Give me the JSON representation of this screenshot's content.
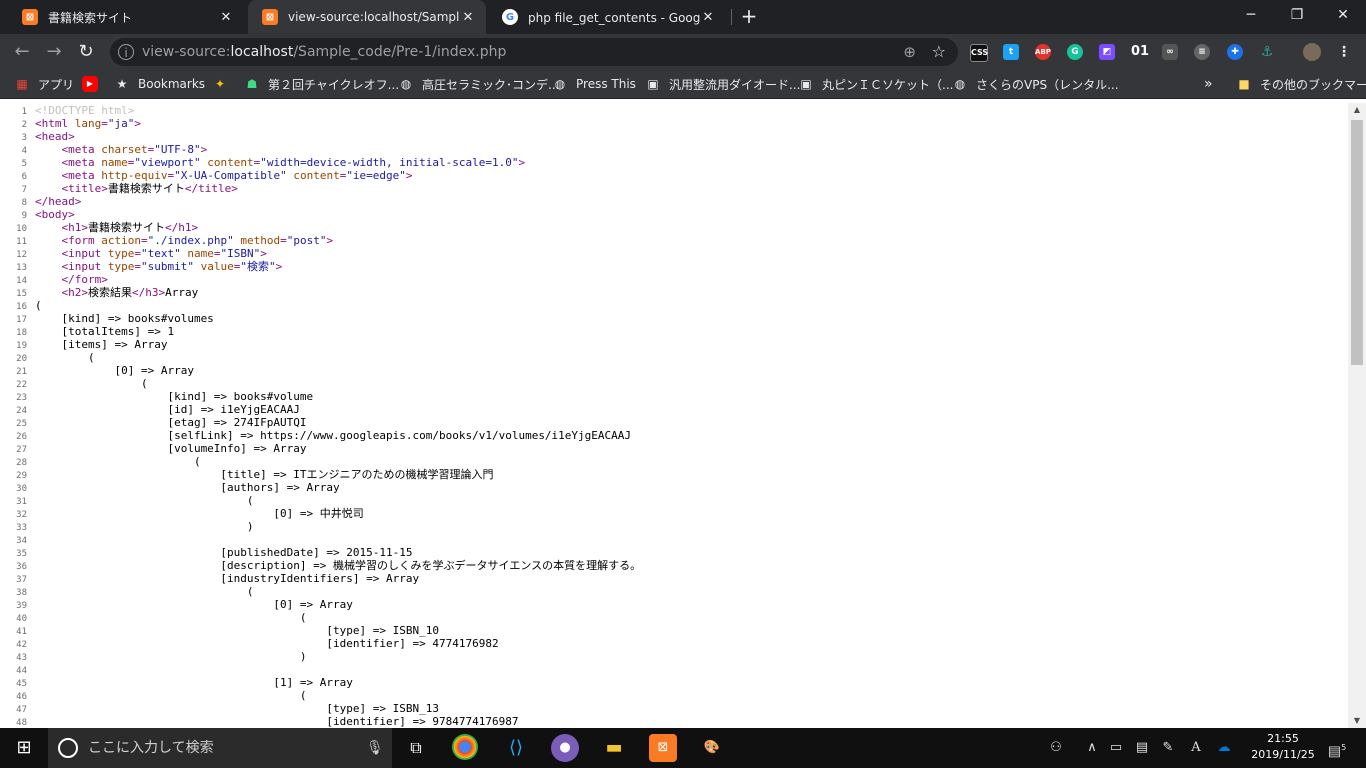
{
  "tabs": [
    {
      "title": "書籍検索サイト",
      "favicon": "xampp-icon",
      "active": false
    },
    {
      "title": "view-source:localhost/Sample_co",
      "favicon": "xampp-icon",
      "active": true
    },
    {
      "title": "php file_get_contents - Google 検",
      "favicon": "google-icon",
      "active": false
    }
  ],
  "window_controls": {
    "minimize": "─",
    "maximize": "❐",
    "close": "✕"
  },
  "toolbar": {
    "url_prefix": "view-source:",
    "url_host": "localhost",
    "url_path": "/Sample_code/Pre-1/index.php",
    "extensions": [
      "CSS",
      "twitter",
      "ABP",
      "grammarly",
      "color",
      "01",
      "cam",
      "chat",
      "plug",
      "tree",
      "avatar"
    ]
  },
  "bookmarks": [
    {
      "label": "アプリ",
      "icon": "apps-grid-icon"
    },
    {
      "label": "",
      "icon": "youtube-icon"
    },
    {
      "label": "Bookmarks",
      "icon": "star-icon"
    },
    {
      "label": "",
      "icon": "colorful-icon"
    },
    {
      "label": "第２回チャイクレオフ...",
      "icon": "android-icon"
    },
    {
      "label": "高圧セラミック･コンデ...",
      "icon": "globe-icon"
    },
    {
      "label": "Press This",
      "icon": "globe-icon"
    },
    {
      "label": "汎用整流用ダイオード...",
      "icon": "chip-icon"
    },
    {
      "label": "丸ピンＩＣソケット（...",
      "icon": "chip-icon"
    },
    {
      "label": "さくらのVPS（レンタル...",
      "icon": "globe-icon"
    },
    {
      "label": "»",
      "icon": ""
    },
    {
      "label": "その他のブックマーク",
      "icon": "folder-icon"
    }
  ],
  "source_lines": [
    [
      [
        "cmt",
        "<!DOCTYPE html>"
      ]
    ],
    [
      [
        "tag",
        "<html "
      ],
      [
        "attr",
        "lang"
      ],
      [
        "tag",
        "="
      ],
      [
        "val",
        "\"ja\""
      ],
      [
        "tag",
        ">"
      ]
    ],
    [
      [
        "tag",
        "<head>"
      ]
    ],
    [
      [
        "txt",
        "    "
      ],
      [
        "tag",
        "<meta "
      ],
      [
        "attr",
        "charset"
      ],
      [
        "tag",
        "="
      ],
      [
        "val",
        "\"UTF-8\""
      ],
      [
        "tag",
        ">"
      ]
    ],
    [
      [
        "txt",
        "    "
      ],
      [
        "tag",
        "<meta "
      ],
      [
        "attr",
        "name"
      ],
      [
        "tag",
        "="
      ],
      [
        "val",
        "\"viewport\""
      ],
      [
        "txt",
        " "
      ],
      [
        "attr",
        "content"
      ],
      [
        "tag",
        "="
      ],
      [
        "val",
        "\"width=device-width, initial-scale=1.0\""
      ],
      [
        "tag",
        ">"
      ]
    ],
    [
      [
        "txt",
        "    "
      ],
      [
        "tag",
        "<meta "
      ],
      [
        "attr",
        "http-equiv"
      ],
      [
        "tag",
        "="
      ],
      [
        "val",
        "\"X-UA-Compatible\""
      ],
      [
        "txt",
        " "
      ],
      [
        "attr",
        "content"
      ],
      [
        "tag",
        "="
      ],
      [
        "val",
        "\"ie=edge\""
      ],
      [
        "tag",
        ">"
      ]
    ],
    [
      [
        "txt",
        "    "
      ],
      [
        "tag",
        "<title>"
      ],
      [
        "txt",
        "書籍検索サイト"
      ],
      [
        "tag",
        "</title>"
      ]
    ],
    [
      [
        "tag",
        "</head>"
      ]
    ],
    [
      [
        "tag",
        "<body>"
      ]
    ],
    [
      [
        "txt",
        "    "
      ],
      [
        "tag",
        "<h1>"
      ],
      [
        "txt",
        "書籍検索サイト"
      ],
      [
        "tag",
        "</h1>"
      ]
    ],
    [
      [
        "txt",
        "    "
      ],
      [
        "tag",
        "<form "
      ],
      [
        "attr",
        "action"
      ],
      [
        "tag",
        "="
      ],
      [
        "val",
        "\"./index.php\""
      ],
      [
        "txt",
        " "
      ],
      [
        "attr",
        "method"
      ],
      [
        "tag",
        "="
      ],
      [
        "val",
        "\"post\""
      ],
      [
        "tag",
        ">"
      ]
    ],
    [
      [
        "txt",
        "    "
      ],
      [
        "tag",
        "<input "
      ],
      [
        "attr",
        "type"
      ],
      [
        "tag",
        "="
      ],
      [
        "val",
        "\"text\""
      ],
      [
        "txt",
        " "
      ],
      [
        "attr",
        "name"
      ],
      [
        "tag",
        "="
      ],
      [
        "val",
        "\"ISBN\""
      ],
      [
        "tag",
        ">"
      ]
    ],
    [
      [
        "txt",
        "    "
      ],
      [
        "tag",
        "<input "
      ],
      [
        "attr",
        "type"
      ],
      [
        "tag",
        "="
      ],
      [
        "val",
        "\"submit\""
      ],
      [
        "txt",
        " "
      ],
      [
        "attr",
        "value"
      ],
      [
        "tag",
        "="
      ],
      [
        "val",
        "\"検索\""
      ],
      [
        "tag",
        ">"
      ]
    ],
    [
      [
        "txt",
        "    "
      ],
      [
        "tag",
        "</form>"
      ]
    ],
    [
      [
        "txt",
        "    "
      ],
      [
        "tag",
        "<h2>"
      ],
      [
        "txt",
        "検索結果"
      ],
      [
        "tag",
        "</h3>"
      ],
      [
        "txt",
        "Array"
      ]
    ],
    [
      [
        "txt",
        "("
      ]
    ],
    [
      [
        "txt",
        "    [kind] => books#volumes"
      ]
    ],
    [
      [
        "txt",
        "    [totalItems] => 1"
      ]
    ],
    [
      [
        "txt",
        "    [items] => Array"
      ]
    ],
    [
      [
        "txt",
        "        ("
      ]
    ],
    [
      [
        "txt",
        "            [0] => Array"
      ]
    ],
    [
      [
        "txt",
        "                ("
      ]
    ],
    [
      [
        "txt",
        "                    [kind] => books#volume"
      ]
    ],
    [
      [
        "txt",
        "                    [id] => i1eYjgEACAAJ"
      ]
    ],
    [
      [
        "txt",
        "                    [etag] => 274IFpAUTQI"
      ]
    ],
    [
      [
        "txt",
        "                    [selfLink] => https://www.googleapis.com/books/v1/volumes/i1eYjgEACAAJ"
      ]
    ],
    [
      [
        "txt",
        "                    [volumeInfo] => Array"
      ]
    ],
    [
      [
        "txt",
        "                        ("
      ]
    ],
    [
      [
        "txt",
        "                            [title] => ITエンジニアのための機械学習理論入門"
      ]
    ],
    [
      [
        "txt",
        "                            [authors] => Array"
      ]
    ],
    [
      [
        "txt",
        "                                ("
      ]
    ],
    [
      [
        "txt",
        "                                    [0] => 中井悦司"
      ]
    ],
    [
      [
        "txt",
        "                                )"
      ]
    ],
    [
      [
        "txt",
        ""
      ]
    ],
    [
      [
        "txt",
        "                            [publishedDate] => 2015-11-15"
      ]
    ],
    [
      [
        "txt",
        "                            [description] => 機械学習のしくみを学ぶデータサイエンスの本質を理解する。"
      ]
    ],
    [
      [
        "txt",
        "                            [industryIdentifiers] => Array"
      ]
    ],
    [
      [
        "txt",
        "                                ("
      ]
    ],
    [
      [
        "txt",
        "                                    [0] => Array"
      ]
    ],
    [
      [
        "txt",
        "                                        ("
      ]
    ],
    [
      [
        "txt",
        "                                            [type] => ISBN_10"
      ]
    ],
    [
      [
        "txt",
        "                                            [identifier] => 4774176982"
      ]
    ],
    [
      [
        "txt",
        "                                        )"
      ]
    ],
    [
      [
        "txt",
        ""
      ]
    ],
    [
      [
        "txt",
        "                                    [1] => Array"
      ]
    ],
    [
      [
        "txt",
        "                                        ("
      ]
    ],
    [
      [
        "txt",
        "                                            [type] => ISBN_13"
      ]
    ],
    [
      [
        "txt",
        "                                            [identifier] => 9784774176987"
      ]
    ]
  ],
  "taskbar": {
    "search_placeholder": "ここに入力して検索",
    "apps": [
      "chrome-icon",
      "vscode-icon",
      "app-icon",
      "explorer-icon",
      "xampp-icon",
      "paint-icon"
    ],
    "tray": [
      "people-icon",
      "chevron-up-icon",
      "battery-icon",
      "display-icon",
      "pen-icon",
      "ime-icon",
      "onedrive-icon"
    ],
    "ime_label": "A",
    "time": "21:55",
    "date": "2019/11/25",
    "notification_count": "5"
  }
}
